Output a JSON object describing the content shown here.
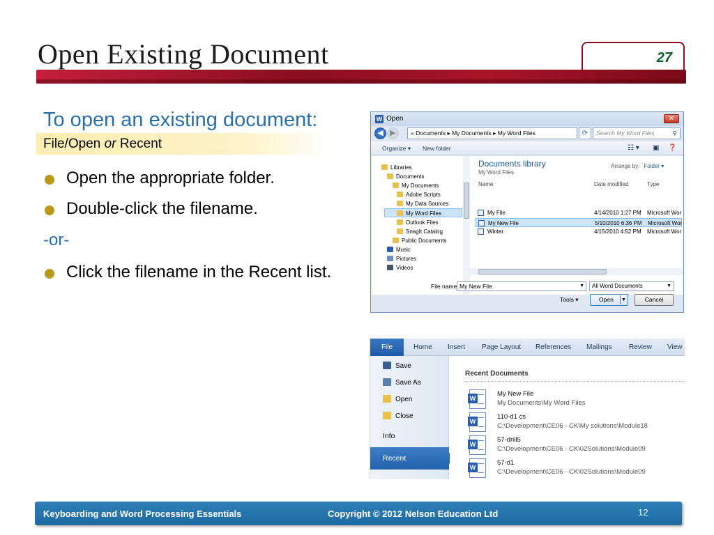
{
  "slide": {
    "title": "Open Existing Document",
    "slide_number": "27",
    "subheading": "To open an existing document:",
    "highlight_pre": "File/Open ",
    "highlight_or": "or",
    "highlight_post": " Recent",
    "bullets": [
      "Open the appropriate folder.",
      "Double-click the filename.",
      "Click the filename in the Recent list."
    ],
    "or_text": "-or-"
  },
  "open_dialog": {
    "title": "Open",
    "close_glyph": "✕",
    "breadcrumb": "« Documents ▸ My Documents ▸ My Word Files",
    "search_placeholder": "Search My Word Files",
    "toolbar": {
      "organize": "Organize ▾",
      "new_folder": "New folder"
    },
    "tree": [
      {
        "label": "Libraries",
        "indent": 0
      },
      {
        "label": "Documents",
        "indent": 1
      },
      {
        "label": "My Documents",
        "indent": 2
      },
      {
        "label": "Adobe Scripts",
        "indent": 3
      },
      {
        "label": "My Data Sources",
        "indent": 3
      },
      {
        "label": "My Word Files",
        "indent": 3,
        "selected": true
      },
      {
        "label": "Outlook Files",
        "indent": 3
      },
      {
        "label": "SnagIt Catalog",
        "indent": 3
      },
      {
        "label": "Public Documents",
        "indent": 2
      },
      {
        "label": "Music",
        "indent": 1
      },
      {
        "label": "Pictures",
        "indent": 1
      },
      {
        "label": "Videos",
        "indent": 1
      }
    ],
    "library_title": "Documents library",
    "library_subtitle": "My Word Files",
    "arrange_label": "Arrange by:",
    "arrange_value": "Folder ▾",
    "columns": [
      "Name",
      "Date modified",
      "Type"
    ],
    "files": [
      {
        "name": "My File",
        "date": "4/14/2010 1:27 PM",
        "type": "Microsoft Wor"
      },
      {
        "name": "My New File",
        "date": "5/10/2010 6:36 PM",
        "type": "Microsoft Wor",
        "selected": true
      },
      {
        "name": "Winter",
        "date": "4/15/2010 4:52 PM",
        "type": "Microsoft Wor"
      }
    ],
    "file_name_label": "File name:",
    "file_name_value": "My New File",
    "file_type": "All Word Documents",
    "tools_label": "Tools",
    "open_button": "Open",
    "cancel_button": "Cancel"
  },
  "backstage": {
    "tabs": [
      "File",
      "Home",
      "Insert",
      "Page Layout",
      "References",
      "Mailings",
      "Review",
      "View"
    ],
    "menu": [
      "Save",
      "Save As",
      "Open",
      "Close"
    ],
    "info": "Info",
    "recent": "Recent",
    "recent_title": "Recent Documents",
    "recent_items": [
      {
        "name": "My New File",
        "path": "My Documents\\My Word Files"
      },
      {
        "name": "110-d1 cs",
        "path": "C:\\Development\\CE06 - CK\\My solutions\\Module18"
      },
      {
        "name": "57-drill5",
        "path": "C:\\Development\\CE06 - CK\\02Solutions\\Module09"
      },
      {
        "name": "57-d1",
        "path": "C:\\Development\\CE06 - CK\\02Solutions\\Module09"
      }
    ]
  },
  "footer": {
    "left": "Keyboarding and Word Processing  Essentials",
    "center": "Copyright © 2012 Nelson Education Ltd",
    "page": "12"
  },
  "colors": {
    "title_bar": "#a81429",
    "accent_blue": "#2a6fa8",
    "bullet": "#b89b1a",
    "footer": "#1d6aa3"
  }
}
